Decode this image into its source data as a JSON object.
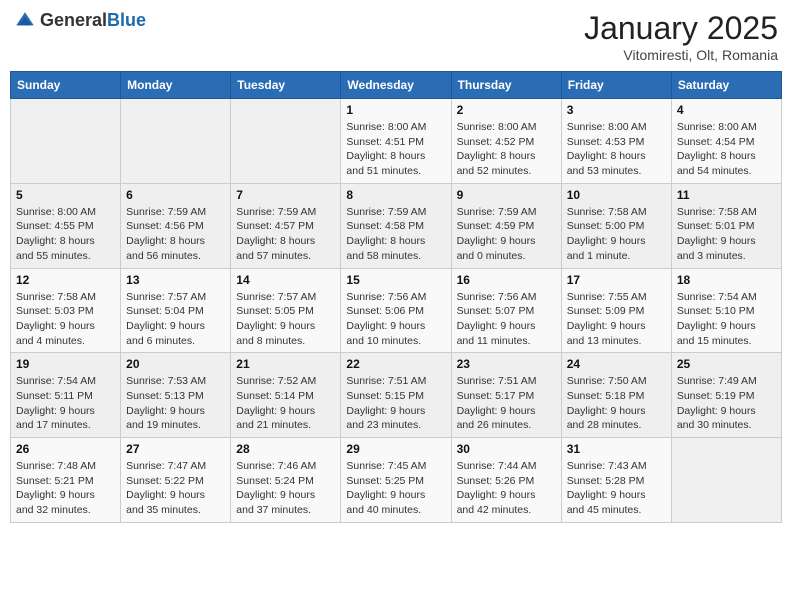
{
  "header": {
    "logo_general": "General",
    "logo_blue": "Blue",
    "month_title": "January 2025",
    "location": "Vitomiresti, Olt, Romania"
  },
  "days_of_week": [
    "Sunday",
    "Monday",
    "Tuesday",
    "Wednesday",
    "Thursday",
    "Friday",
    "Saturday"
  ],
  "weeks": [
    [
      {
        "day": "",
        "info": ""
      },
      {
        "day": "",
        "info": ""
      },
      {
        "day": "",
        "info": ""
      },
      {
        "day": "1",
        "info": "Sunrise: 8:00 AM\nSunset: 4:51 PM\nDaylight: 8 hours and 51 minutes."
      },
      {
        "day": "2",
        "info": "Sunrise: 8:00 AM\nSunset: 4:52 PM\nDaylight: 8 hours and 52 minutes."
      },
      {
        "day": "3",
        "info": "Sunrise: 8:00 AM\nSunset: 4:53 PM\nDaylight: 8 hours and 53 minutes."
      },
      {
        "day": "4",
        "info": "Sunrise: 8:00 AM\nSunset: 4:54 PM\nDaylight: 8 hours and 54 minutes."
      }
    ],
    [
      {
        "day": "5",
        "info": "Sunrise: 8:00 AM\nSunset: 4:55 PM\nDaylight: 8 hours and 55 minutes."
      },
      {
        "day": "6",
        "info": "Sunrise: 7:59 AM\nSunset: 4:56 PM\nDaylight: 8 hours and 56 minutes."
      },
      {
        "day": "7",
        "info": "Sunrise: 7:59 AM\nSunset: 4:57 PM\nDaylight: 8 hours and 57 minutes."
      },
      {
        "day": "8",
        "info": "Sunrise: 7:59 AM\nSunset: 4:58 PM\nDaylight: 8 hours and 58 minutes."
      },
      {
        "day": "9",
        "info": "Sunrise: 7:59 AM\nSunset: 4:59 PM\nDaylight: 9 hours and 0 minutes."
      },
      {
        "day": "10",
        "info": "Sunrise: 7:58 AM\nSunset: 5:00 PM\nDaylight: 9 hours and 1 minute."
      },
      {
        "day": "11",
        "info": "Sunrise: 7:58 AM\nSunset: 5:01 PM\nDaylight: 9 hours and 3 minutes."
      }
    ],
    [
      {
        "day": "12",
        "info": "Sunrise: 7:58 AM\nSunset: 5:03 PM\nDaylight: 9 hours and 4 minutes."
      },
      {
        "day": "13",
        "info": "Sunrise: 7:57 AM\nSunset: 5:04 PM\nDaylight: 9 hours and 6 minutes."
      },
      {
        "day": "14",
        "info": "Sunrise: 7:57 AM\nSunset: 5:05 PM\nDaylight: 9 hours and 8 minutes."
      },
      {
        "day": "15",
        "info": "Sunrise: 7:56 AM\nSunset: 5:06 PM\nDaylight: 9 hours and 10 minutes."
      },
      {
        "day": "16",
        "info": "Sunrise: 7:56 AM\nSunset: 5:07 PM\nDaylight: 9 hours and 11 minutes."
      },
      {
        "day": "17",
        "info": "Sunrise: 7:55 AM\nSunset: 5:09 PM\nDaylight: 9 hours and 13 minutes."
      },
      {
        "day": "18",
        "info": "Sunrise: 7:54 AM\nSunset: 5:10 PM\nDaylight: 9 hours and 15 minutes."
      }
    ],
    [
      {
        "day": "19",
        "info": "Sunrise: 7:54 AM\nSunset: 5:11 PM\nDaylight: 9 hours and 17 minutes."
      },
      {
        "day": "20",
        "info": "Sunrise: 7:53 AM\nSunset: 5:13 PM\nDaylight: 9 hours and 19 minutes."
      },
      {
        "day": "21",
        "info": "Sunrise: 7:52 AM\nSunset: 5:14 PM\nDaylight: 9 hours and 21 minutes."
      },
      {
        "day": "22",
        "info": "Sunrise: 7:51 AM\nSunset: 5:15 PM\nDaylight: 9 hours and 23 minutes."
      },
      {
        "day": "23",
        "info": "Sunrise: 7:51 AM\nSunset: 5:17 PM\nDaylight: 9 hours and 26 minutes."
      },
      {
        "day": "24",
        "info": "Sunrise: 7:50 AM\nSunset: 5:18 PM\nDaylight: 9 hours and 28 minutes."
      },
      {
        "day": "25",
        "info": "Sunrise: 7:49 AM\nSunset: 5:19 PM\nDaylight: 9 hours and 30 minutes."
      }
    ],
    [
      {
        "day": "26",
        "info": "Sunrise: 7:48 AM\nSunset: 5:21 PM\nDaylight: 9 hours and 32 minutes."
      },
      {
        "day": "27",
        "info": "Sunrise: 7:47 AM\nSunset: 5:22 PM\nDaylight: 9 hours and 35 minutes."
      },
      {
        "day": "28",
        "info": "Sunrise: 7:46 AM\nSunset: 5:24 PM\nDaylight: 9 hours and 37 minutes."
      },
      {
        "day": "29",
        "info": "Sunrise: 7:45 AM\nSunset: 5:25 PM\nDaylight: 9 hours and 40 minutes."
      },
      {
        "day": "30",
        "info": "Sunrise: 7:44 AM\nSunset: 5:26 PM\nDaylight: 9 hours and 42 minutes."
      },
      {
        "day": "31",
        "info": "Sunrise: 7:43 AM\nSunset: 5:28 PM\nDaylight: 9 hours and 45 minutes."
      },
      {
        "day": "",
        "info": ""
      }
    ]
  ]
}
